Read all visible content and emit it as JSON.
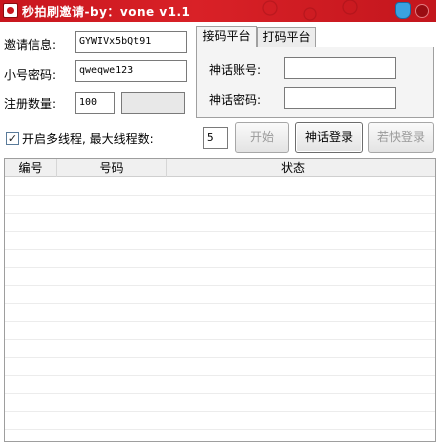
{
  "window": {
    "title": "秒拍刷邀请-by：vone   v1.1"
  },
  "form": {
    "invite_label": "邀请信息:",
    "invite_value": "GYWIVx5bQt91",
    "password_label": "小号密码:",
    "password_value": "qweqwe123",
    "count_label": "注册数量:",
    "count_value": "100",
    "count_extra_value": ""
  },
  "tabs": {
    "items": [
      {
        "label": "接码平台"
      },
      {
        "label": "打码平台"
      }
    ],
    "active": 0,
    "account_label": "神话账号:",
    "account_value": "",
    "password_label": "神话密码:",
    "password_value": ""
  },
  "controls": {
    "multithread_label": "开启多线程, 最大线程数:",
    "multithread_checked": true,
    "thread_count": "5",
    "start_button": "开始",
    "shenhua_login_button": "神话登录",
    "ruokuai_login_button": "若快登录"
  },
  "table": {
    "columns": [
      "编号",
      "号码",
      "状态"
    ],
    "rows": []
  },
  "colors": {
    "titlebar": "#c8161e",
    "accent": "#3aa2e0"
  }
}
